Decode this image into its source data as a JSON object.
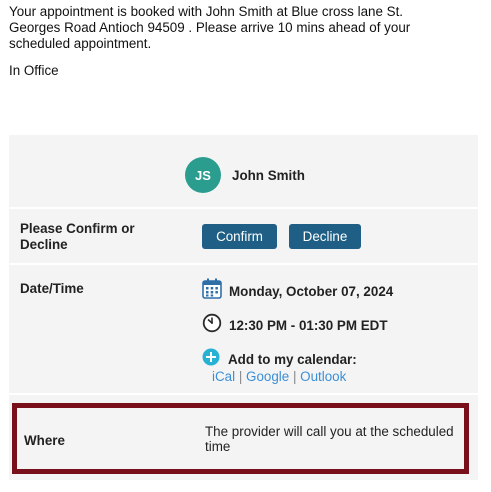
{
  "message": {
    "intro": "Your appointment is booked with John Smith at Blue cross lane St. Georges Road Antioch 94509 . Please arrive 10 mins ahead of your scheduled appointment.",
    "location_type": "In Office"
  },
  "provider": {
    "initials": "JS",
    "name": "John Smith",
    "avatar_color": "#2a9d8f"
  },
  "confirm_row": {
    "label": "Please Confirm or Decline",
    "confirm_label": "Confirm",
    "decline_label": "Decline",
    "button_color": "#1f5f85"
  },
  "datetime_row": {
    "label": "Date/Time",
    "date": "Monday, October 07, 2024",
    "time": "12:30 PM - 01:30 PM EDT",
    "date_icon": "calendar-icon",
    "time_icon": "clock-icon",
    "add_icon": "plus-circle-icon",
    "add_calendar_label": "Add to my calendar:",
    "calendar_links": [
      "iCal",
      "Google",
      "Outlook"
    ],
    "link_separator": "|"
  },
  "where_row": {
    "label": "Where",
    "value": "The provider will call you at the scheduled time",
    "highlight_color": "#7a0f1c"
  }
}
